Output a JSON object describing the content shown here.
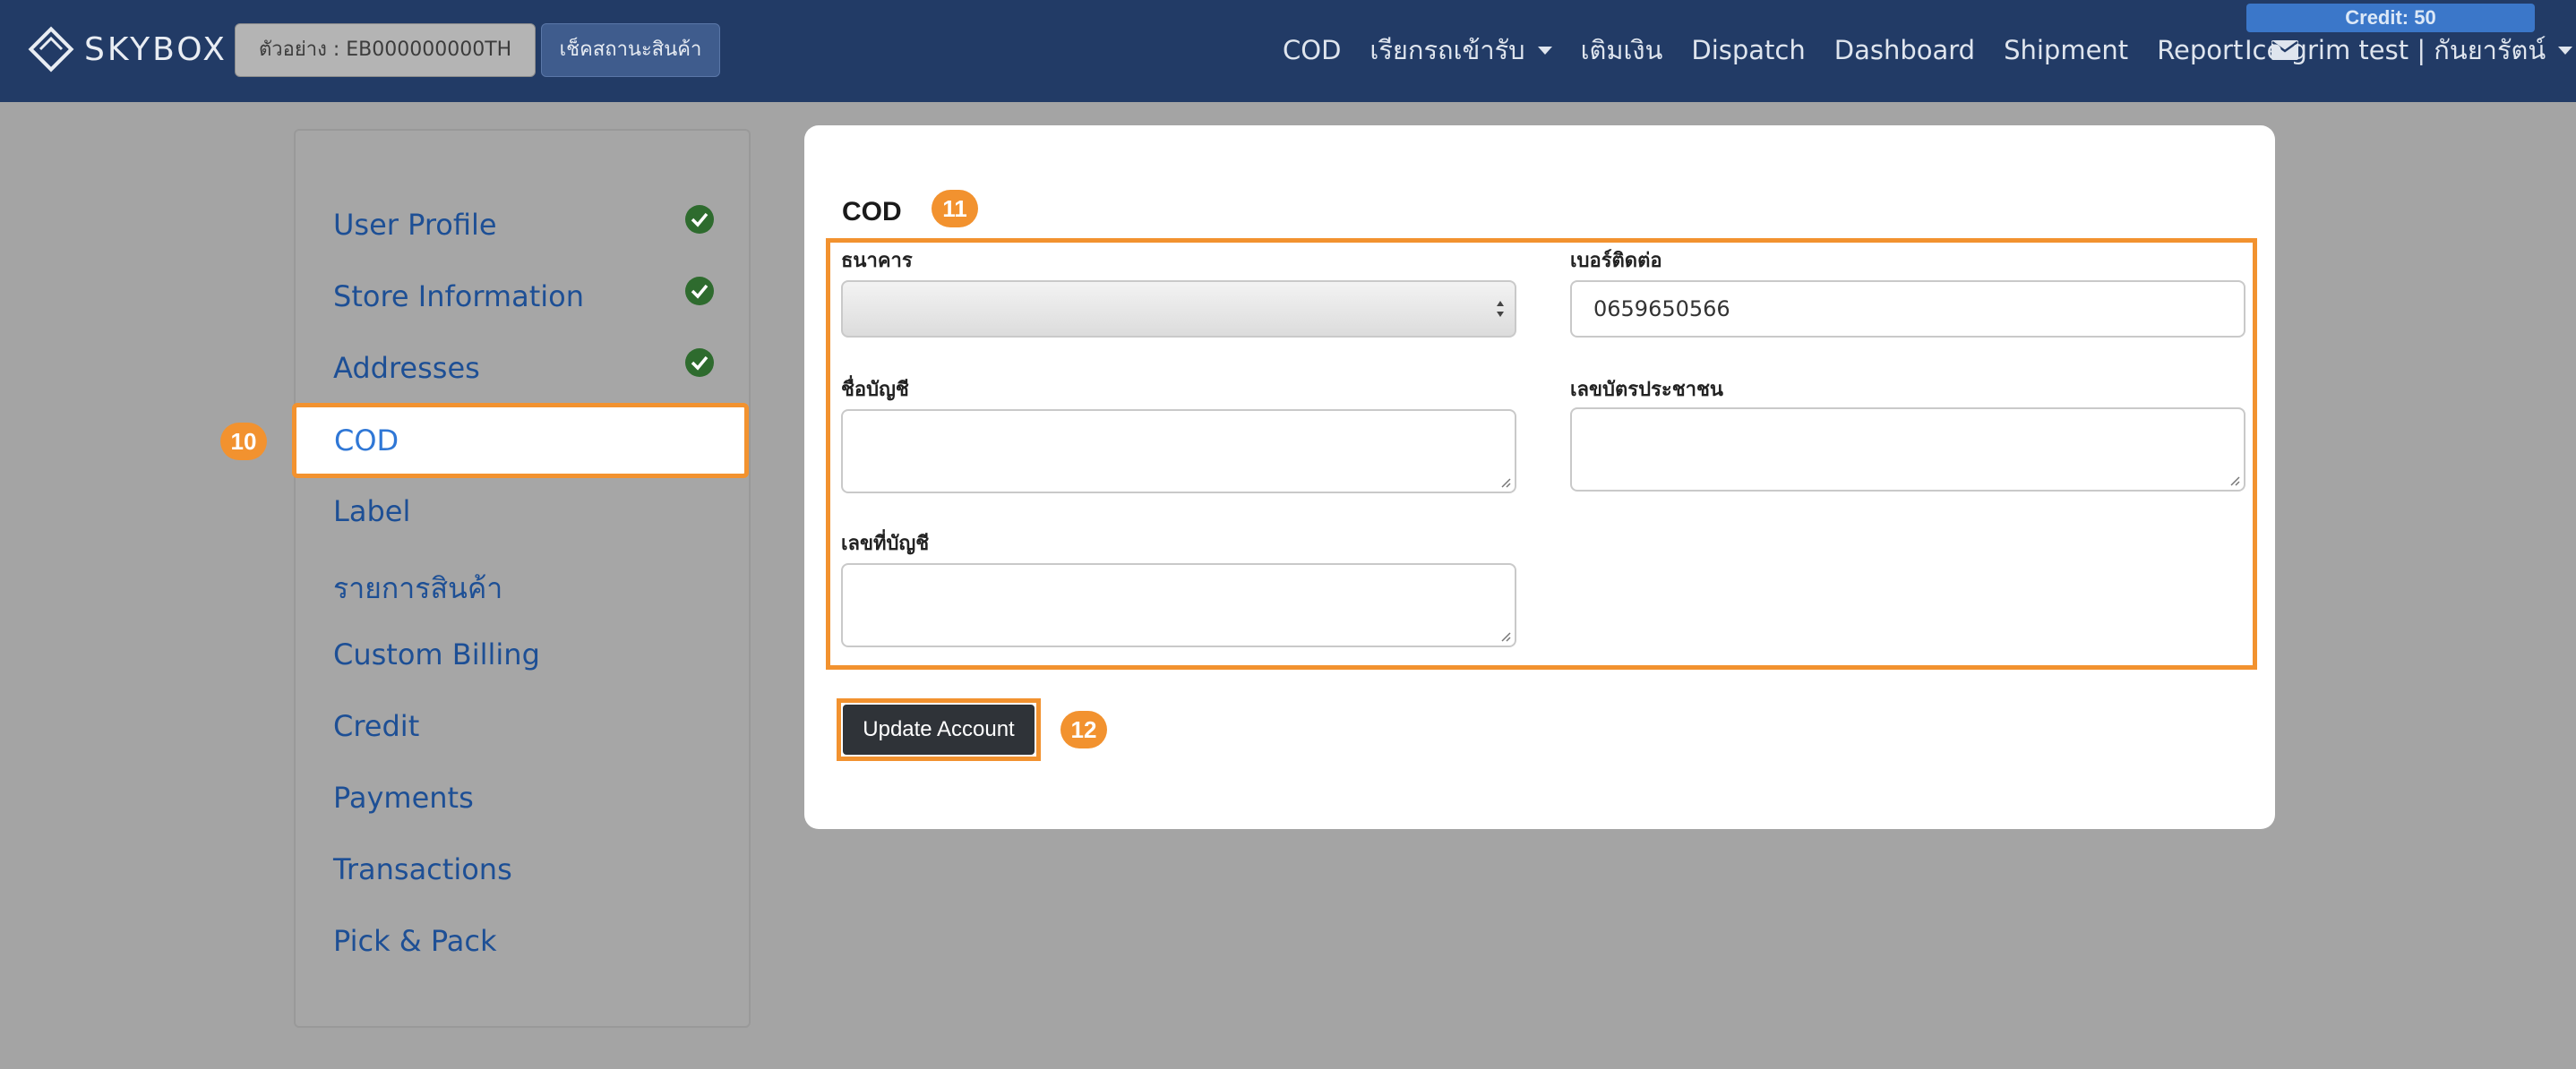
{
  "navbar": {
    "brand": "SKYBOX",
    "track_placeholder": "ตัวอย่าง : EB000000000TH",
    "track_button": "เช็คสถานะสินค้า",
    "links": [
      "COD",
      "เรียกรถเข้ารับ",
      "เติมเงิน",
      "Dispatch",
      "Dashboard",
      "Shipment",
      "Report"
    ],
    "credit": "Credit: 50",
    "user": "Ice grim test | กันยารัตน์"
  },
  "sidebar": {
    "items": [
      "User Profile",
      "Store Information",
      "Addresses",
      "COD",
      "Label",
      "รายการสินค้า",
      "Custom Billing",
      "Credit",
      "Payments",
      "Transactions",
      "Pick & Pack"
    ],
    "active": "COD"
  },
  "badges": {
    "sidebar": "10",
    "form": "11",
    "button": "12"
  },
  "form": {
    "title": "COD",
    "bank_label": "ธนาคาร",
    "bank_value": "",
    "phone_label": "เบอร์ติดต่อ",
    "phone_value": "0659650566",
    "account_name_label": "ชื่อบัญชี",
    "account_name_value": "",
    "id_card_label": "เลขบัตรประชาชน",
    "id_card_value": "",
    "account_no_label": "เลขที่บัญชี",
    "account_no_value": "",
    "submit": "Update Account"
  },
  "colors": {
    "navbar": "#223b66",
    "highlight": "#f2922f",
    "link": "#1d4f95",
    "check": "#2e6b2e"
  }
}
